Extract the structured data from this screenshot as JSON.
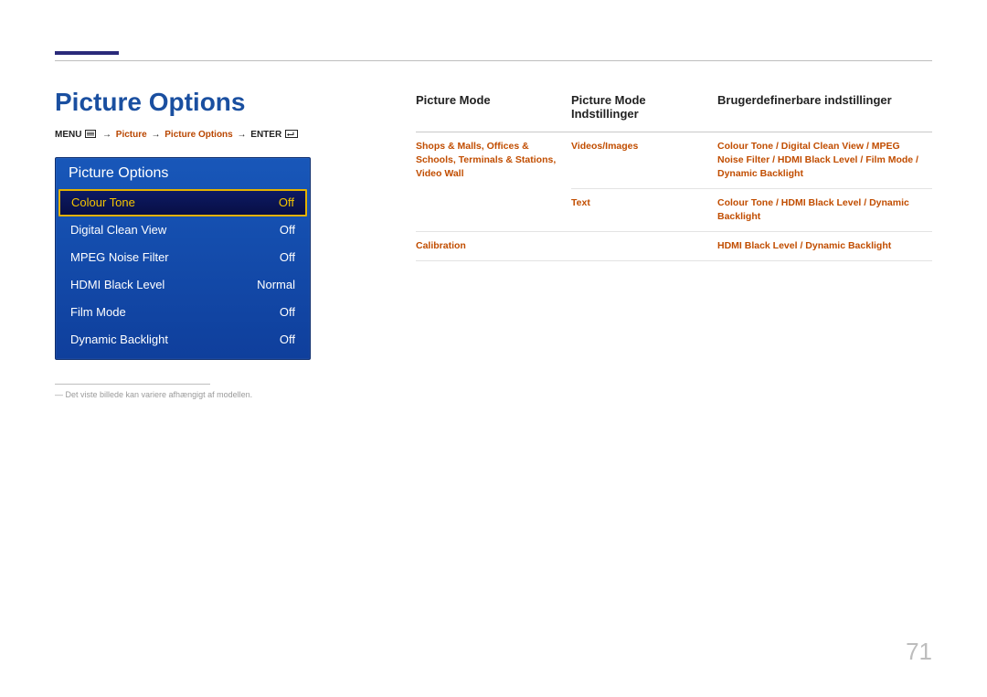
{
  "page_number": "71",
  "section_title": "Picture Options",
  "breadcrumb": {
    "menu": "MENU",
    "arrow": "→",
    "picture": "Picture",
    "picture_options": "Picture Options",
    "enter": "ENTER"
  },
  "osd": {
    "title": "Picture Options",
    "rows": [
      {
        "label": "Colour Tone",
        "value": "Off",
        "selected": true
      },
      {
        "label": "Digital Clean View",
        "value": "Off",
        "selected": false
      },
      {
        "label": "MPEG Noise Filter",
        "value": "Off",
        "selected": false
      },
      {
        "label": "HDMI Black Level",
        "value": "Normal",
        "selected": false
      },
      {
        "label": "Film Mode",
        "value": "Off",
        "selected": false
      },
      {
        "label": "Dynamic Backlight",
        "value": "Off",
        "selected": false
      }
    ]
  },
  "footnote": "― Det viste billede kan variere afhængigt af modellen.",
  "table": {
    "headers": {
      "col1": "Picture Mode",
      "col2_line1": "Picture Mode",
      "col2_line2": "Indstillinger",
      "col3": "Brugerdefinerbare indstillinger"
    },
    "rows": [
      {
        "c1": "Shops & Malls, Offices & Schools, Terminals & Stations, Video Wall",
        "c2": "Videos/Images",
        "c3": "Colour Tone / Digital Clean View / MPEG Noise Filter / HDMI Black Level / Film Mode / Dynamic Backlight"
      },
      {
        "c1": "",
        "c2": "Text",
        "c3": "Colour Tone / HDMI Black Level / Dynamic Backlight"
      },
      {
        "c1": "Calibration",
        "c2": "",
        "c3": "HDMI Black Level / Dynamic Backlight"
      }
    ]
  }
}
